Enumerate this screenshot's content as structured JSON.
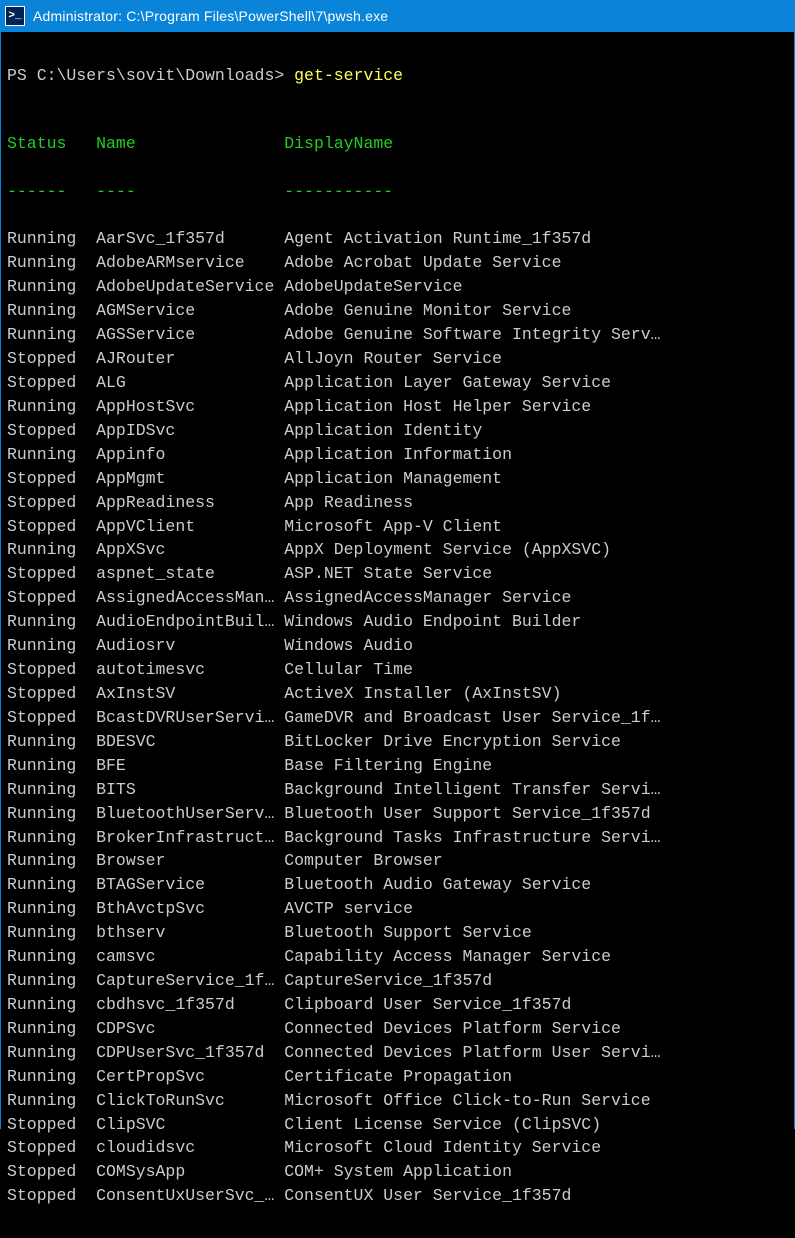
{
  "window": {
    "icon_label": ">_",
    "title": "Administrator: C:\\Program Files\\PowerShell\\7\\pwsh.exe"
  },
  "prompt": {
    "path": "PS C:\\Users\\sovit\\Downloads> ",
    "command": "get-service"
  },
  "headers": {
    "status": "Status",
    "name": "Name",
    "displayname": "DisplayName"
  },
  "dashes": {
    "status": "------",
    "name": "----",
    "displayname": "-----------"
  },
  "rows": [
    {
      "status": "Running",
      "name": "AarSvc_1f357d",
      "display": "Agent Activation Runtime_1f357d"
    },
    {
      "status": "Running",
      "name": "AdobeARMservice",
      "display": "Adobe Acrobat Update Service"
    },
    {
      "status": "Running",
      "name": "AdobeUpdateService",
      "display": "AdobeUpdateService"
    },
    {
      "status": "Running",
      "name": "AGMService",
      "display": "Adobe Genuine Monitor Service"
    },
    {
      "status": "Running",
      "name": "AGSService",
      "display": "Adobe Genuine Software Integrity Serv…"
    },
    {
      "status": "Stopped",
      "name": "AJRouter",
      "display": "AllJoyn Router Service"
    },
    {
      "status": "Stopped",
      "name": "ALG",
      "display": "Application Layer Gateway Service"
    },
    {
      "status": "Running",
      "name": "AppHostSvc",
      "display": "Application Host Helper Service"
    },
    {
      "status": "Stopped",
      "name": "AppIDSvc",
      "display": "Application Identity"
    },
    {
      "status": "Running",
      "name": "Appinfo",
      "display": "Application Information"
    },
    {
      "status": "Stopped",
      "name": "AppMgmt",
      "display": "Application Management"
    },
    {
      "status": "Stopped",
      "name": "AppReadiness",
      "display": "App Readiness"
    },
    {
      "status": "Stopped",
      "name": "AppVClient",
      "display": "Microsoft App-V Client"
    },
    {
      "status": "Running",
      "name": "AppXSvc",
      "display": "AppX Deployment Service (AppXSVC)"
    },
    {
      "status": "Stopped",
      "name": "aspnet_state",
      "display": "ASP.NET State Service"
    },
    {
      "status": "Stopped",
      "name": "AssignedAccessMan…",
      "display": "AssignedAccessManager Service"
    },
    {
      "status": "Running",
      "name": "AudioEndpointBuil…",
      "display": "Windows Audio Endpoint Builder"
    },
    {
      "status": "Running",
      "name": "Audiosrv",
      "display": "Windows Audio"
    },
    {
      "status": "Stopped",
      "name": "autotimesvc",
      "display": "Cellular Time"
    },
    {
      "status": "Stopped",
      "name": "AxInstSV",
      "display": "ActiveX Installer (AxInstSV)"
    },
    {
      "status": "Stopped",
      "name": "BcastDVRUserServi…",
      "display": "GameDVR and Broadcast User Service_1f…"
    },
    {
      "status": "Running",
      "name": "BDESVC",
      "display": "BitLocker Drive Encryption Service"
    },
    {
      "status": "Running",
      "name": "BFE",
      "display": "Base Filtering Engine"
    },
    {
      "status": "Running",
      "name": "BITS",
      "display": "Background Intelligent Transfer Servi…"
    },
    {
      "status": "Running",
      "name": "BluetoothUserServ…",
      "display": "Bluetooth User Support Service_1f357d"
    },
    {
      "status": "Running",
      "name": "BrokerInfrastruct…",
      "display": "Background Tasks Infrastructure Servi…"
    },
    {
      "status": "Running",
      "name": "Browser",
      "display": "Computer Browser"
    },
    {
      "status": "Running",
      "name": "BTAGService",
      "display": "Bluetooth Audio Gateway Service"
    },
    {
      "status": "Running",
      "name": "BthAvctpSvc",
      "display": "AVCTP service"
    },
    {
      "status": "Running",
      "name": "bthserv",
      "display": "Bluetooth Support Service"
    },
    {
      "status": "Running",
      "name": "camsvc",
      "display": "Capability Access Manager Service"
    },
    {
      "status": "Running",
      "name": "CaptureService_1f…",
      "display": "CaptureService_1f357d"
    },
    {
      "status": "Running",
      "name": "cbdhsvc_1f357d",
      "display": "Clipboard User Service_1f357d"
    },
    {
      "status": "Running",
      "name": "CDPSvc",
      "display": "Connected Devices Platform Service"
    },
    {
      "status": "Running",
      "name": "CDPUserSvc_1f357d",
      "display": "Connected Devices Platform User Servi…"
    },
    {
      "status": "Running",
      "name": "CertPropSvc",
      "display": "Certificate Propagation"
    },
    {
      "status": "Running",
      "name": "ClickToRunSvc",
      "display": "Microsoft Office Click-to-Run Service"
    },
    {
      "status": "Stopped",
      "name": "ClipSVC",
      "display": "Client License Service (ClipSVC)"
    },
    {
      "status": "Stopped",
      "name": "cloudidsvc",
      "display": "Microsoft Cloud Identity Service"
    },
    {
      "status": "Stopped",
      "name": "COMSysApp",
      "display": "COM+ System Application"
    },
    {
      "status": "Stopped",
      "name": "ConsentUxUserSvc_…",
      "display": "ConsentUX User Service_1f357d"
    }
  ]
}
